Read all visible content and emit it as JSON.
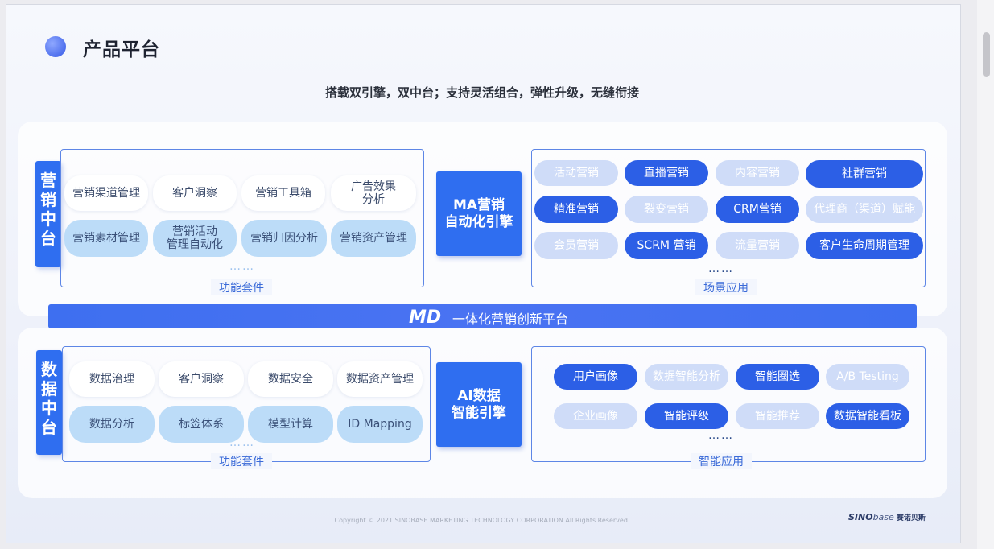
{
  "title": "产品平台",
  "subtitle": "搭载双引擎，双中台；支持灵活组合，弹性升级，无缝衔接",
  "marketing": {
    "label": [
      "营",
      "销",
      "中",
      "台"
    ],
    "functions": [
      "营销渠道管理",
      "客户洞察",
      "营销工具箱",
      "广告效果\n分析",
      "营销素材管理",
      "营销活动\n管理自动化",
      "营销归因分析",
      "营销资产管理"
    ],
    "functions_caption": "功能套件",
    "engine": "MA营销\n自动化引擎",
    "scenes": [
      "活动营销",
      "直播营销",
      "内容营销",
      "社群营销",
      "精准营销",
      "裂变营销",
      "CRM营销",
      "代理商（渠道）赋能",
      "会员营销",
      "SCRM 营销",
      "流量营销",
      "客户生命周期管理"
    ],
    "scenes_caption": "场景应用",
    "dots": "……"
  },
  "platform": {
    "logo_text": "MD",
    "name": "一体化营销创新平台"
  },
  "data_mid": {
    "label": [
      "数",
      "据",
      "中",
      "台"
    ],
    "functions": [
      "数据治理",
      "客户洞察",
      "数据安全",
      "数据资产管理",
      "数据分析",
      "标签体系",
      "模型计算",
      "ID Mapping"
    ],
    "functions_caption": "功能套件",
    "engine": "AI数据\n智能引擎",
    "apps": [
      "用户画像",
      "数据智能分析",
      "智能圈选",
      "A/B Testing",
      "企业画像",
      "智能评级",
      "智能推荐",
      "数据智能看板"
    ],
    "apps_caption": "智能应用",
    "dots": "……"
  },
  "footer": {
    "copyright": "Copyright © 2021  SINOBASE MARKETING TECHNOLOGY CORPORATION All Rights Reserved.",
    "brand_a": "SINO",
    "brand_b": "base",
    "brand_c": "赛诺贝斯"
  },
  "colors": {
    "accent": "#2f6ef0",
    "dark_pill": "#2c5fe6",
    "light_pill": "#bcdcf8",
    "pale_pill": "#cfdcf8"
  }
}
